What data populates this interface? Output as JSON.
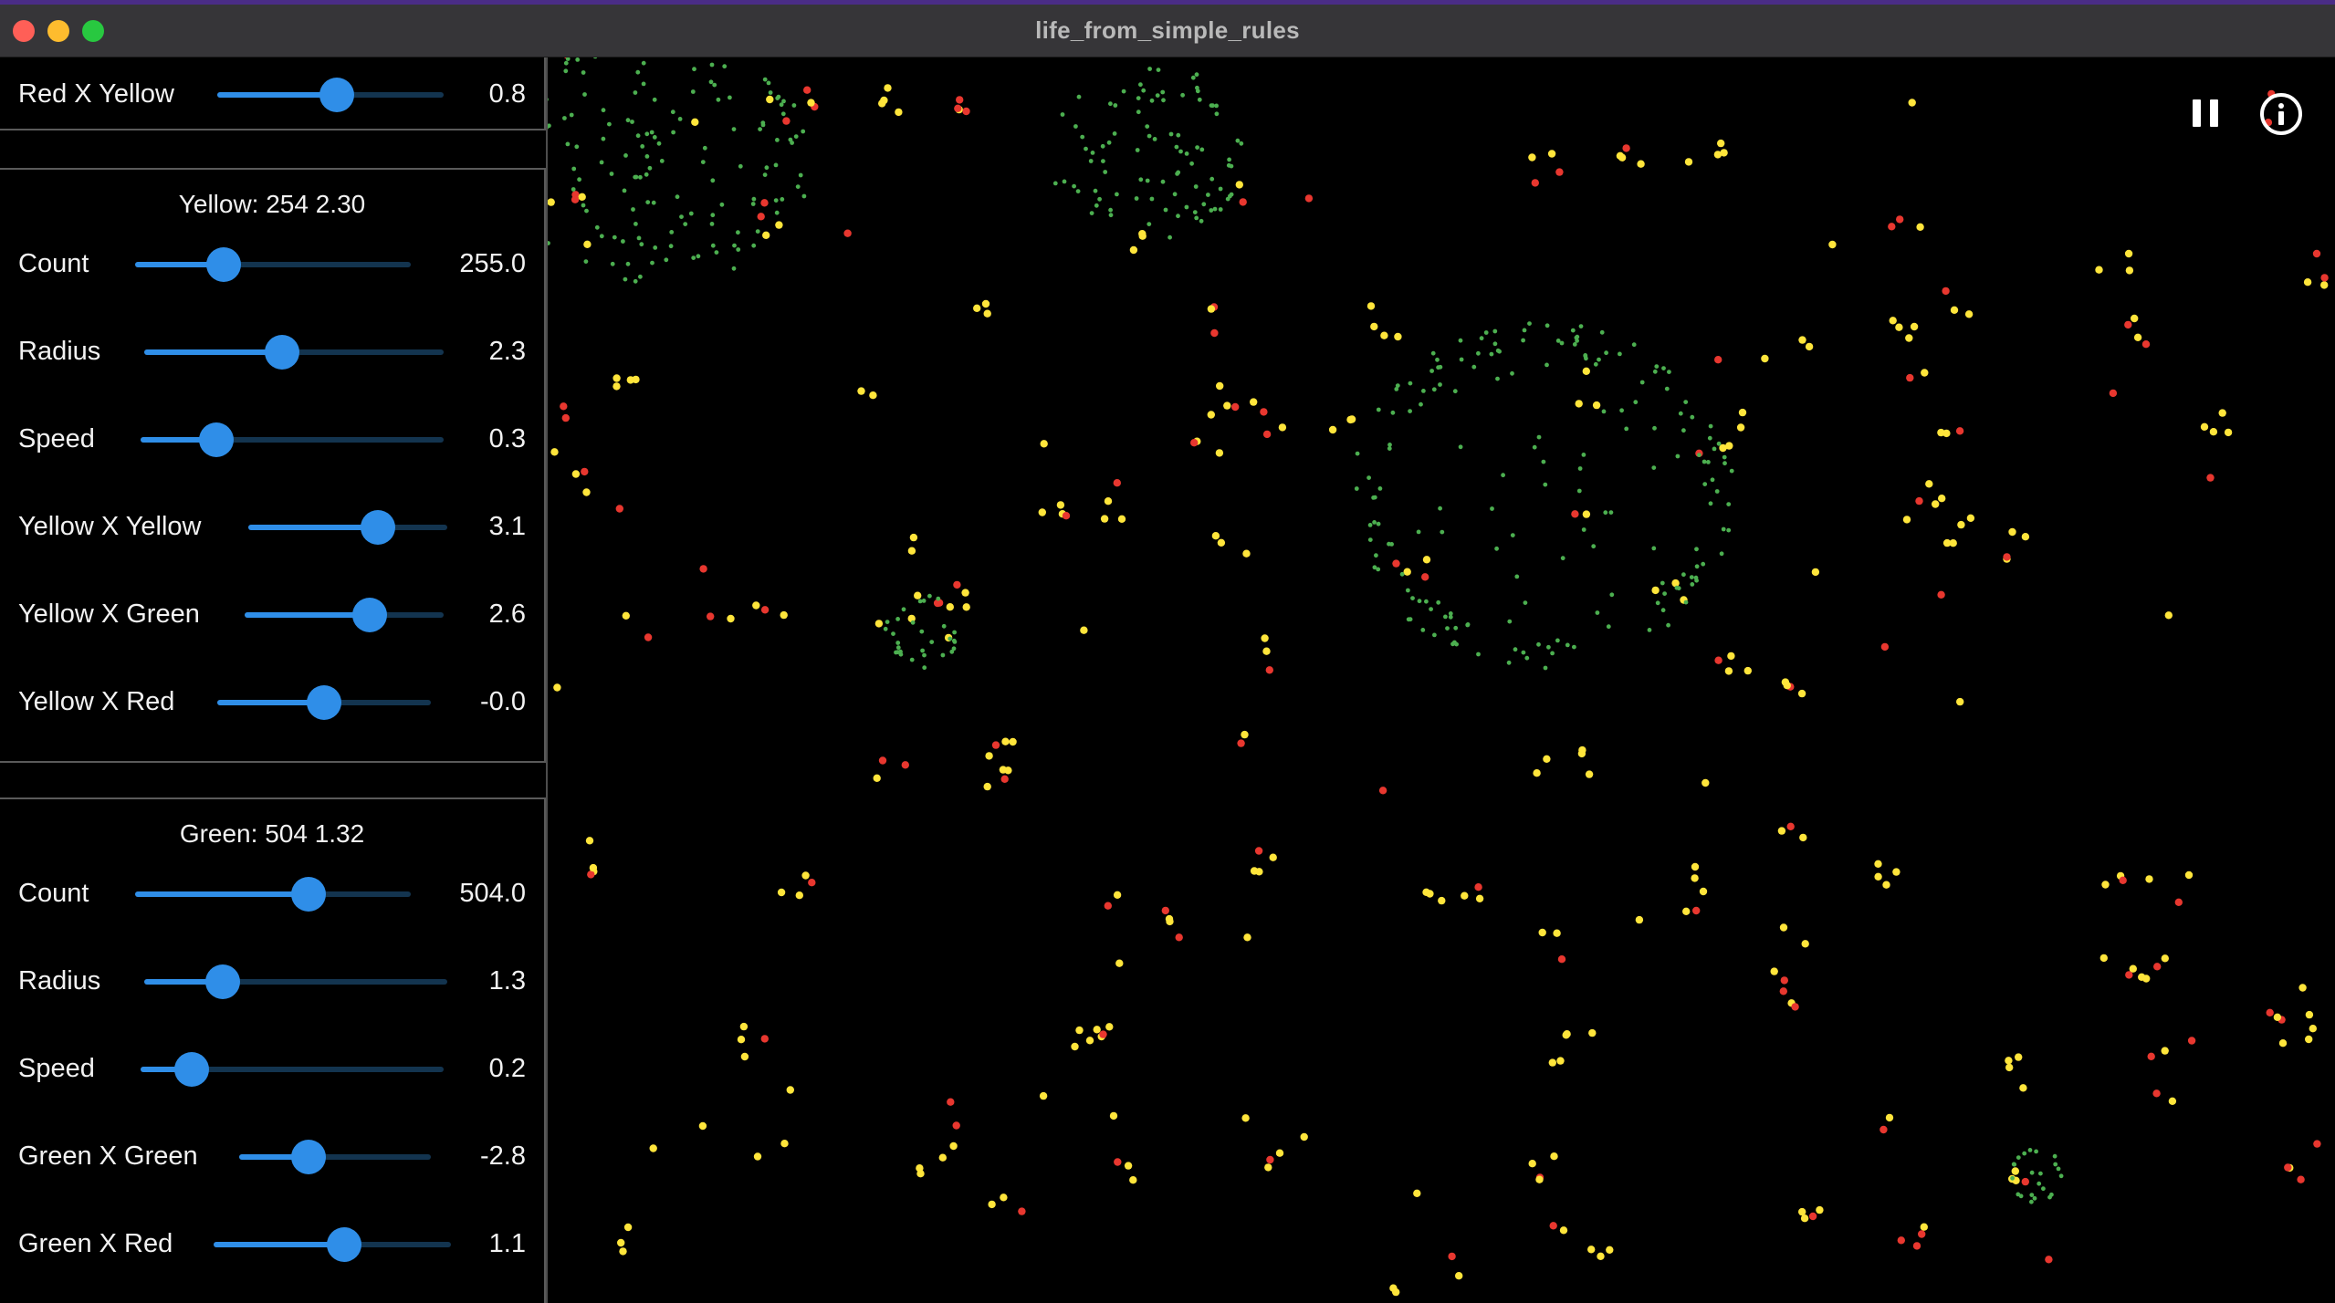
{
  "window": {
    "title": "life_from_simple_rules"
  },
  "sidebar": {
    "top_fragment": {
      "label": "Red X Yellow",
      "value": "0.8",
      "fraction": 0.53
    },
    "yellow_panel": {
      "title": "Yellow: 254 2.30",
      "rows": [
        {
          "label": "Count",
          "value": "255.0",
          "fraction": 0.32
        },
        {
          "label": "Radius",
          "value": "2.3",
          "fraction": 0.46
        },
        {
          "label": "Speed",
          "value": "0.3",
          "fraction": 0.25
        },
        {
          "label": "Yellow X Yellow",
          "value": "3.1",
          "fraction": 0.65
        },
        {
          "label": "Yellow X Green",
          "value": "2.6",
          "fraction": 0.63
        },
        {
          "label": "Yellow X Red",
          "value": "-0.0",
          "fraction": 0.5
        }
      ]
    },
    "green_panel": {
      "title": "Green: 504 1.32",
      "rows": [
        {
          "label": "Count",
          "value": "504.0",
          "fraction": 0.63
        },
        {
          "label": "Radius",
          "value": "1.3",
          "fraction": 0.26
        },
        {
          "label": "Speed",
          "value": "0.2",
          "fraction": 0.17
        },
        {
          "label": "Green X Green",
          "value": "-2.8",
          "fraction": 0.36
        },
        {
          "label": "Green X Red",
          "value": "1.1",
          "fraction": 0.55
        }
      ]
    }
  },
  "controls": {
    "pause_icon": "pause-icon",
    "info_icon": "info-icon"
  },
  "colors": {
    "yellow_particle": "#ffe53b",
    "red_particle": "#e8372f",
    "green_particle": "#4caf50",
    "slider_accent": "#2f8ee8",
    "slider_track": "#13344f"
  }
}
